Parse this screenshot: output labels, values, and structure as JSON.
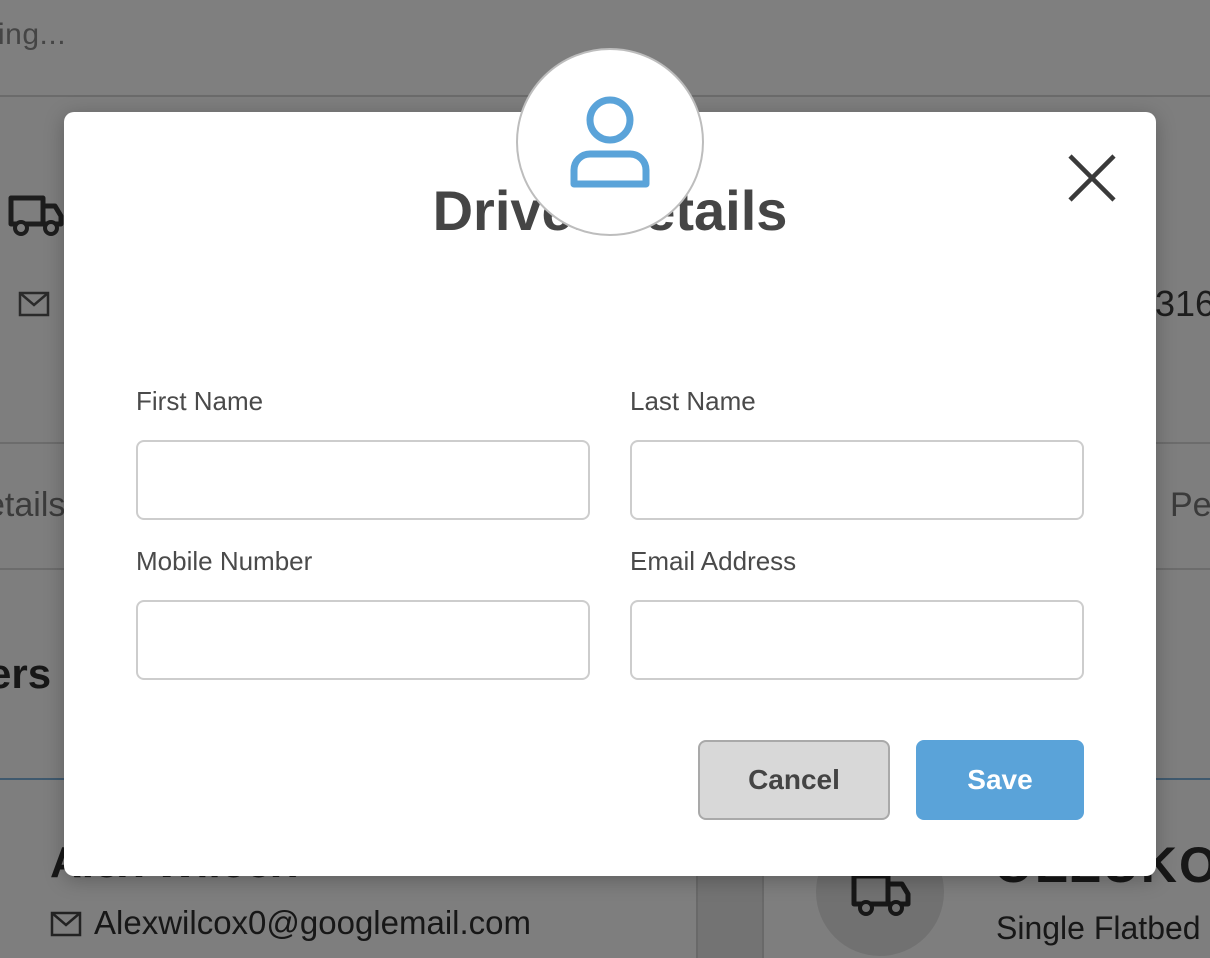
{
  "background": {
    "loading_text": "ing...",
    "phone_fragment": "316",
    "tab_left_fragment": "etails",
    "tab_right_fragment": "Pe",
    "section_title_fragment": "ers",
    "driver_card": {
      "name": "Alex Wilcox",
      "email": "Alexwilcox0@googlemail.com"
    },
    "vehicle_card": {
      "registration_fragment": "OEZUKO",
      "type": "Single Flatbed"
    }
  },
  "modal": {
    "icon": "user-icon",
    "close_icon": "close-icon",
    "title": "Driver details",
    "fields": {
      "first_name": {
        "label": "First Name",
        "value": ""
      },
      "last_name": {
        "label": "Last Name",
        "value": ""
      },
      "mobile": {
        "label": "Mobile Number",
        "value": ""
      },
      "email": {
        "label": "Email Address",
        "value": ""
      }
    },
    "buttons": {
      "cancel": "Cancel",
      "save": "Save"
    }
  },
  "colors": {
    "accent": "#5aa3d9",
    "title_text": "#454545",
    "cancel_bg": "#d8d8d8"
  }
}
